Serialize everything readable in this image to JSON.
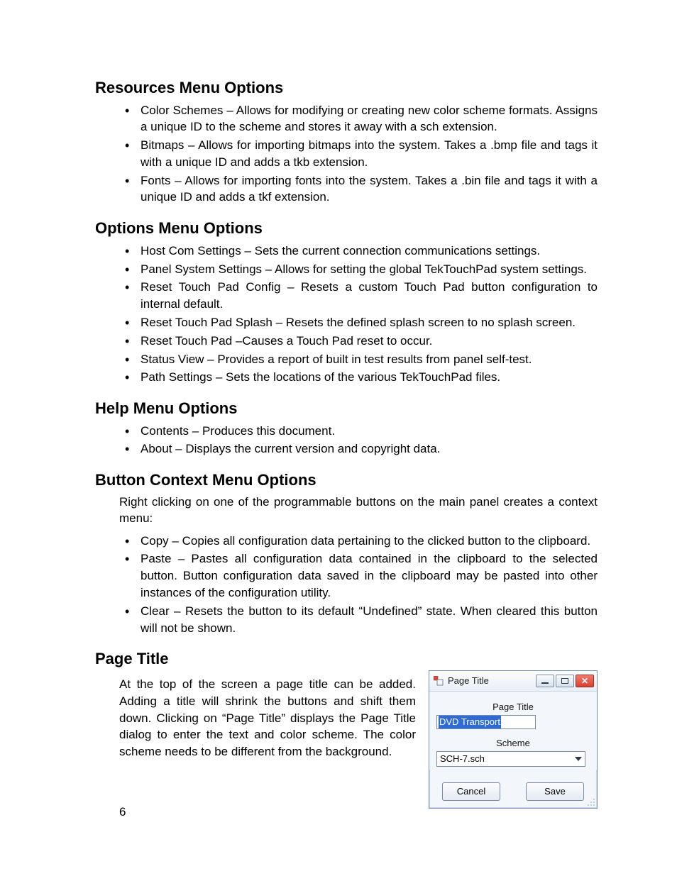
{
  "page_number": "6",
  "sections": {
    "resources": {
      "heading": "Resources Menu Options",
      "items": [
        "Color Schemes – Allows for modifying or creating new color scheme formats. Assigns a unique ID to the scheme and stores it away with a sch extension.",
        "Bitmaps – Allows for importing bitmaps into the system. Takes a .bmp file and tags it with a unique ID and adds a tkb extension.",
        "Fonts – Allows for importing fonts into the system. Takes a .bin file and tags it with a unique ID and adds a tkf extension."
      ]
    },
    "options": {
      "heading": "Options Menu Options",
      "items": [
        "Host Com Settings – Sets the current connection communications settings.",
        "Panel System Settings – Allows for setting the global TekTouchPad system settings.",
        "Reset Touch Pad Config – Resets a custom Touch Pad button configuration to internal default.",
        "Reset Touch Pad Splash – Resets the defined splash screen to no splash screen.",
        "Reset Touch Pad –Causes a Touch Pad reset to occur.",
        "Status View – Provides a report of built in test results from panel self-test.",
        "Path Settings – Sets the locations of the various TekTouchPad files."
      ]
    },
    "help": {
      "heading": "Help Menu Options",
      "items": [
        "Contents – Produces this document.",
        "About – Displays the current version and copyright data."
      ]
    },
    "context": {
      "heading": "Button Context Menu Options",
      "lead": "Right clicking on one of the programmable buttons on the main panel creates a context menu:",
      "items": [
        "Copy – Copies all configuration data pertaining to the clicked button to the clipboard.",
        "Paste – Pastes all configuration data contained in the clipboard to the selected button. Button configuration data saved in the clipboard may be pasted into other instances of the configuration utility.",
        "Clear – Resets the button to its default “Undefined” state. When cleared this button will not be shown."
      ]
    },
    "pagetitle": {
      "heading": "Page Title",
      "body": "At the top of the screen a page title can be added. Adding a title will shrink the buttons and shift them down. Clicking on “Page Title” displays the Page Title dialog to enter the text and color scheme. The color scheme needs to be different from the background."
    }
  },
  "dialog": {
    "window_title": "Page Title",
    "field_label": "Page Title",
    "field_value": "DVD Transport",
    "scheme_label": "Scheme",
    "scheme_value": "SCH-7.sch",
    "cancel": "Cancel",
    "save": "Save"
  }
}
